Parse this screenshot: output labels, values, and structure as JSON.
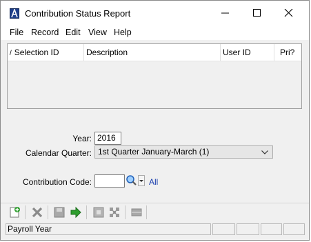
{
  "window": {
    "title": "Contribution Status Report"
  },
  "menu": [
    "File",
    "Record",
    "Edit",
    "View",
    "Help"
  ],
  "grid": {
    "columns": [
      "Selection ID",
      "Description",
      "User ID",
      "Pri?"
    ],
    "rows": []
  },
  "form": {
    "year_label": "Year:",
    "year_value": "2016",
    "quarter_label": "Calendar Quarter:",
    "quarter_value": "1st Quarter January-March (1)",
    "code_label": "Contribution Code:",
    "code_value": "",
    "all_link": "All"
  },
  "toolbar": {
    "icons": [
      "new-record-icon",
      "delete-icon",
      "save-icon",
      "run-icon",
      "select-icon",
      "expand-icon",
      "disabled-bar-icon"
    ]
  },
  "status": {
    "text": "Payroll Year"
  },
  "colors": {
    "accent": "#1e3f8a",
    "link": "#1a3fae",
    "run_arrow": "#2e9e2e"
  }
}
